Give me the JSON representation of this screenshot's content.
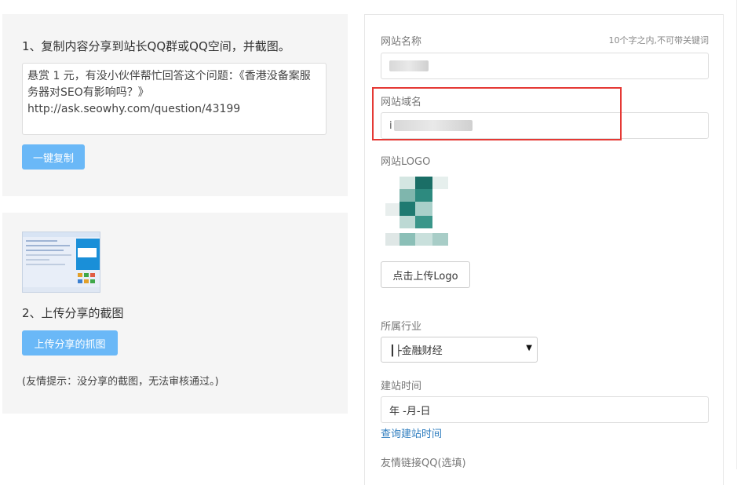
{
  "share": {
    "step1_title": "1、复制内容分享到站长QQ群或QQ空间，并截图。",
    "share_text_line1": "悬赏 1 元，有没小伙伴帮忙回答这个问题：《香港没备案服",
    "share_text_line2": "务器对SEO有影响吗？》",
    "share_text_line3": "http://ask.seowhy.com/question/43199",
    "copy_button": "一键复制"
  },
  "upload": {
    "step2_title": "2、上传分享的截图",
    "upload_button": "上传分享的抓图",
    "hint": "(友情提示：没分享的截图，无法审核通过。)"
  },
  "form": {
    "site_name_label": "网站名称",
    "site_name_note": "10个字之内,不可带关键词",
    "domain_label": "网站域名",
    "domain_value_prefix": "i",
    "logo_label": "网站LOGO",
    "upload_logo_button": "点击上传Logo",
    "industry_label": "所属行业",
    "industry_selected": "┃├金融财经",
    "founded_label": "建站时间",
    "founded_value": "年 -月-日",
    "query_link": "查询建站时间",
    "friend_qq_label": "友情链接QQ(选填)"
  },
  "colors": {
    "button_blue": "#6ab8f7",
    "link_blue": "#2e7dbf",
    "highlight_red": "#e53935",
    "panel_bg": "#f5f5f5",
    "logo_teal": "#1a6e66"
  }
}
